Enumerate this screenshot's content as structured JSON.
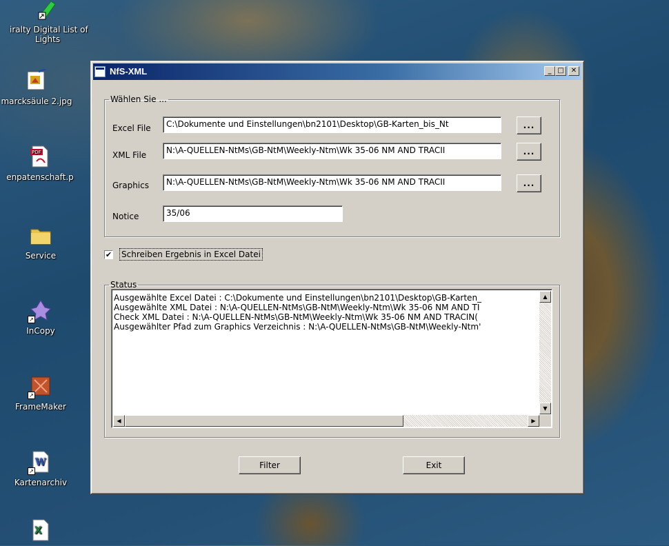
{
  "desktop": {
    "icons": [
      {
        "label_line1": "iralty Digital List of",
        "label_line2": "Lights"
      },
      {
        "label": "marcksäule 2.jpg"
      },
      {
        "label": "enpatenschaft.p"
      },
      {
        "label": "Service"
      },
      {
        "label": "InCopy"
      },
      {
        "label": "FrameMaker"
      },
      {
        "label": "Kartenarchiv"
      }
    ]
  },
  "window": {
    "title": "NfS-XML",
    "controls": {
      "minimize": "_",
      "maximize": "□",
      "close": "✕"
    }
  },
  "select_group": {
    "legend": "Wählen Sie ...",
    "rows": [
      {
        "label": "Excel File",
        "value": "C:\\Dokumente und Einstellungen\\bn2101\\Desktop\\GB-Karten_bis_Nt",
        "browse": "..."
      },
      {
        "label": "XML File",
        "value": "N:\\A-QUELLEN-NtMs\\GB-NtM\\Weekly-Ntm\\Wk 35-06 NM AND TRACII",
        "browse": "..."
      },
      {
        "label": "Graphics",
        "value": "N:\\A-QUELLEN-NtMs\\GB-NtM\\Weekly-Ntm\\Wk 35-06 NM AND TRACII",
        "browse": "..."
      },
      {
        "label": "Notice",
        "value": "35/06"
      }
    ]
  },
  "write_excel": {
    "label": "Schreiben Ergebnis in  Excel Datei",
    "checked": true,
    "mark": "✔"
  },
  "status_group": {
    "legend": "Status",
    "lines": [
      "Ausgewählte Excel Datei : C:\\Dokumente und Einstellungen\\bn2101\\Desktop\\GB-Karten_",
      "Ausgewählte XML Datei : N:\\A-QUELLEN-NtMs\\GB-NtM\\Weekly-Ntm\\Wk 35-06 NM AND TI",
      "Check XML Datei : N:\\A-QUELLEN-NtMs\\GB-NtM\\Weekly-Ntm\\Wk 35-06 NM AND TRACIN(",
      "Ausgewählter Pfad zum Graphics Verzeichnis : N:\\A-QUELLEN-NtMs\\GB-NtM\\Weekly-Ntm'"
    ]
  },
  "buttons": {
    "filter": "Filter",
    "exit": "Exit"
  },
  "scroll_glyphs": {
    "up": "▲",
    "down": "▼",
    "left": "◀",
    "right": "▶"
  }
}
